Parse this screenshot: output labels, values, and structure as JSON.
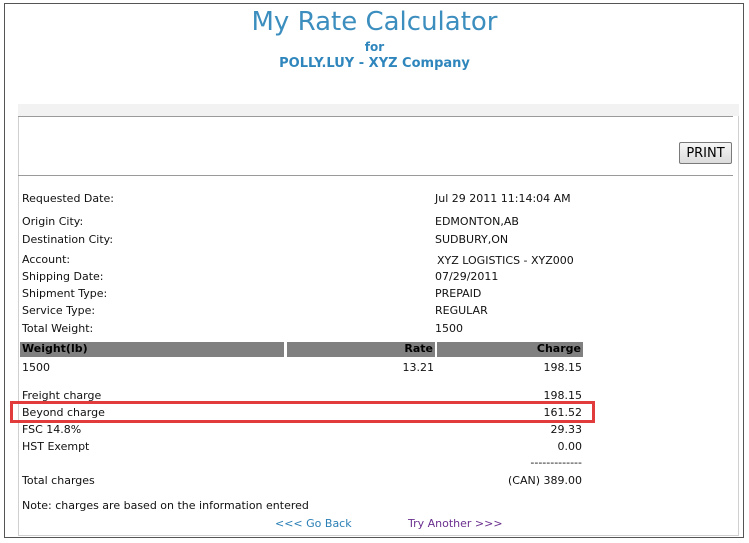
{
  "header": {
    "title": "My Rate Calculator",
    "for_label": "for",
    "company": "POLLY.LUY - XYZ Company"
  },
  "toolbar": {
    "print_label": "PRINT"
  },
  "details": [
    {
      "label": "Requested Date:",
      "value": "Jul 29 2011 11:14:04 AM"
    },
    {
      "label": "Origin City:",
      "value": "EDMONTON,AB"
    },
    {
      "label": "Destination City:",
      "value": "SUDBURY,ON"
    },
    {
      "label": "Account:",
      "value": "XYZ LOGISTICS - XYZ000"
    },
    {
      "label": "Shipping Date:",
      "value": "07/29/2011"
    },
    {
      "label": "Shipment Type:",
      "value": "PREPAID"
    },
    {
      "label": "Service Type:",
      "value": "REGULAR"
    },
    {
      "label": "Total Weight:",
      "value": "1500"
    }
  ],
  "rate_table": {
    "headers": [
      "Weight(lb)",
      "Rate",
      "Charge"
    ],
    "rows": [
      {
        "weight": "1500",
        "rate": "13.21",
        "charge": "198.15"
      }
    ]
  },
  "charges": [
    {
      "label": "Freight charge",
      "value": "198.15"
    },
    {
      "label": "Beyond charge",
      "value": "161.52"
    },
    {
      "label": "FSC 14.8%",
      "value": "29.33"
    },
    {
      "label": "HST Exempt",
      "value": "0.00"
    }
  ],
  "separator": "-------------",
  "total": {
    "label": "Total charges",
    "value": "(CAN) 389.00"
  },
  "note": "Note: charges are based on the information entered",
  "links": {
    "back": "<<< Go Back",
    "another": "Try Another >>>"
  }
}
